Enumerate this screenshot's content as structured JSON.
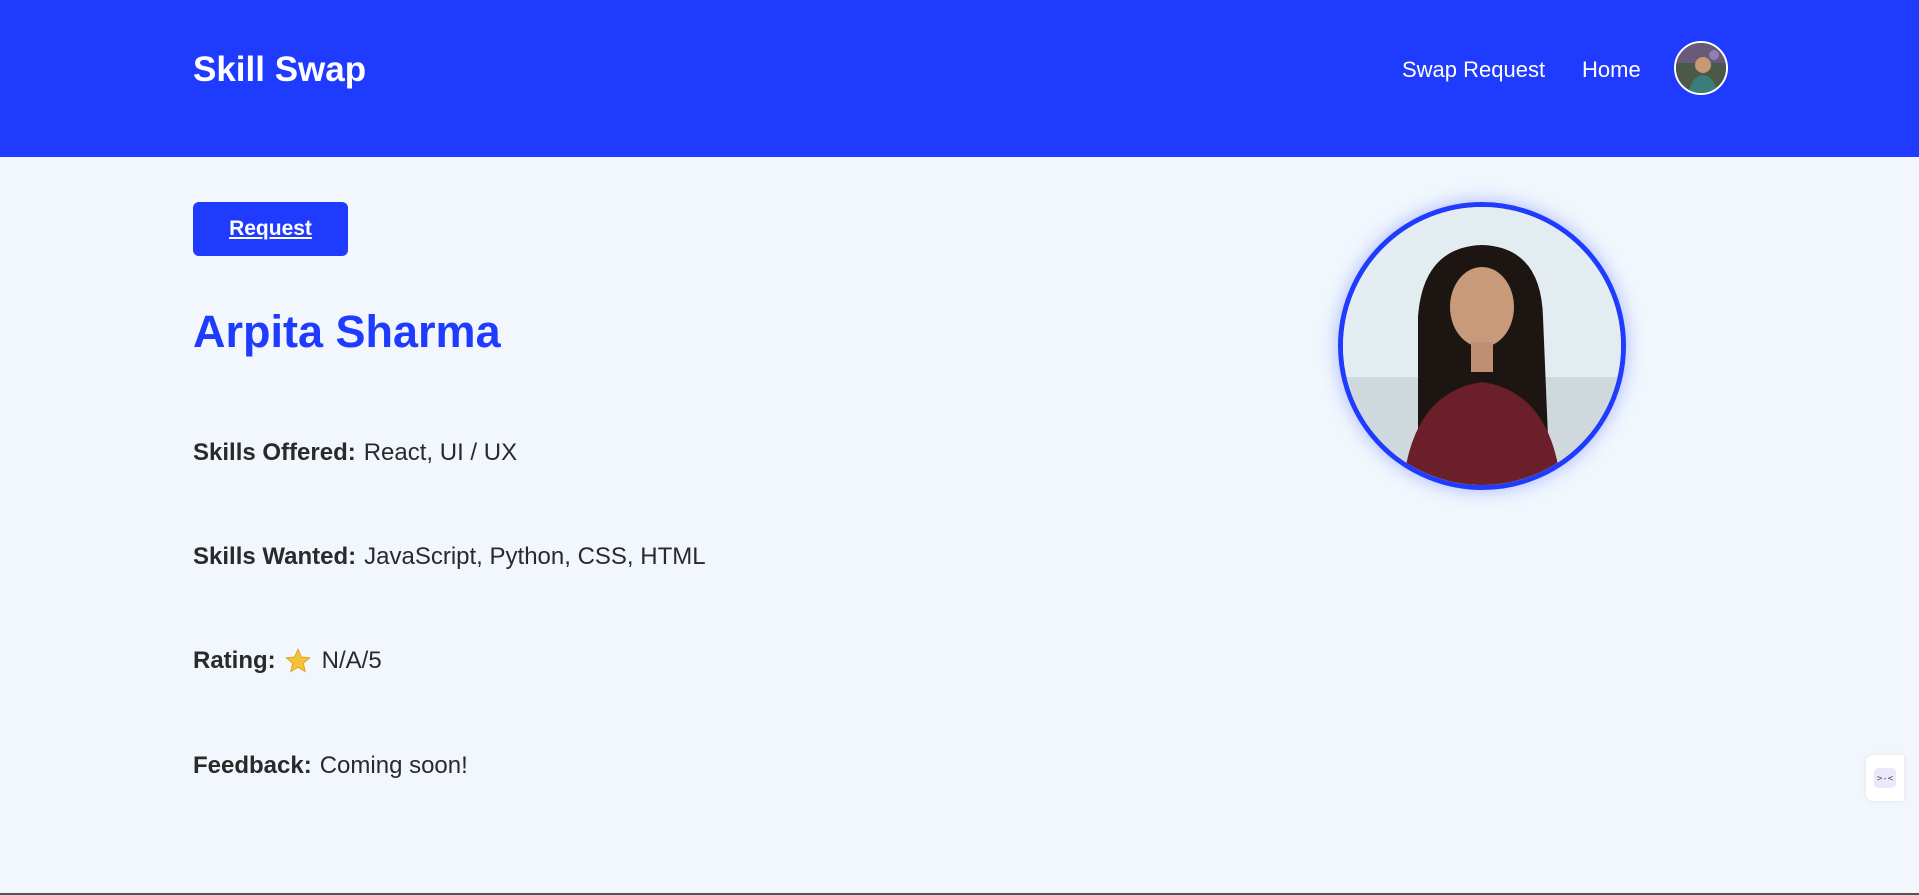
{
  "header": {
    "brand": "Skill Swap",
    "nav": {
      "swap_request": "Swap Request",
      "home": "Home"
    },
    "accent_color": "#1f3bfd"
  },
  "profile": {
    "request_button": "Request",
    "name": "Arpita Sharma",
    "skills_offered_label": "Skills Offered:",
    "skills_offered_value": "React, UI / UX",
    "skills_wanted_label": "Skills Wanted:",
    "skills_wanted_value": "JavaScript, Python, CSS, HTML",
    "rating_label": "Rating:",
    "rating_icon": "star-icon",
    "rating_value": "N/A/5",
    "feedback_label": "Feedback:",
    "feedback_value": "Coming soon!"
  },
  "widget": {
    "icon": "chat-face-icon"
  }
}
